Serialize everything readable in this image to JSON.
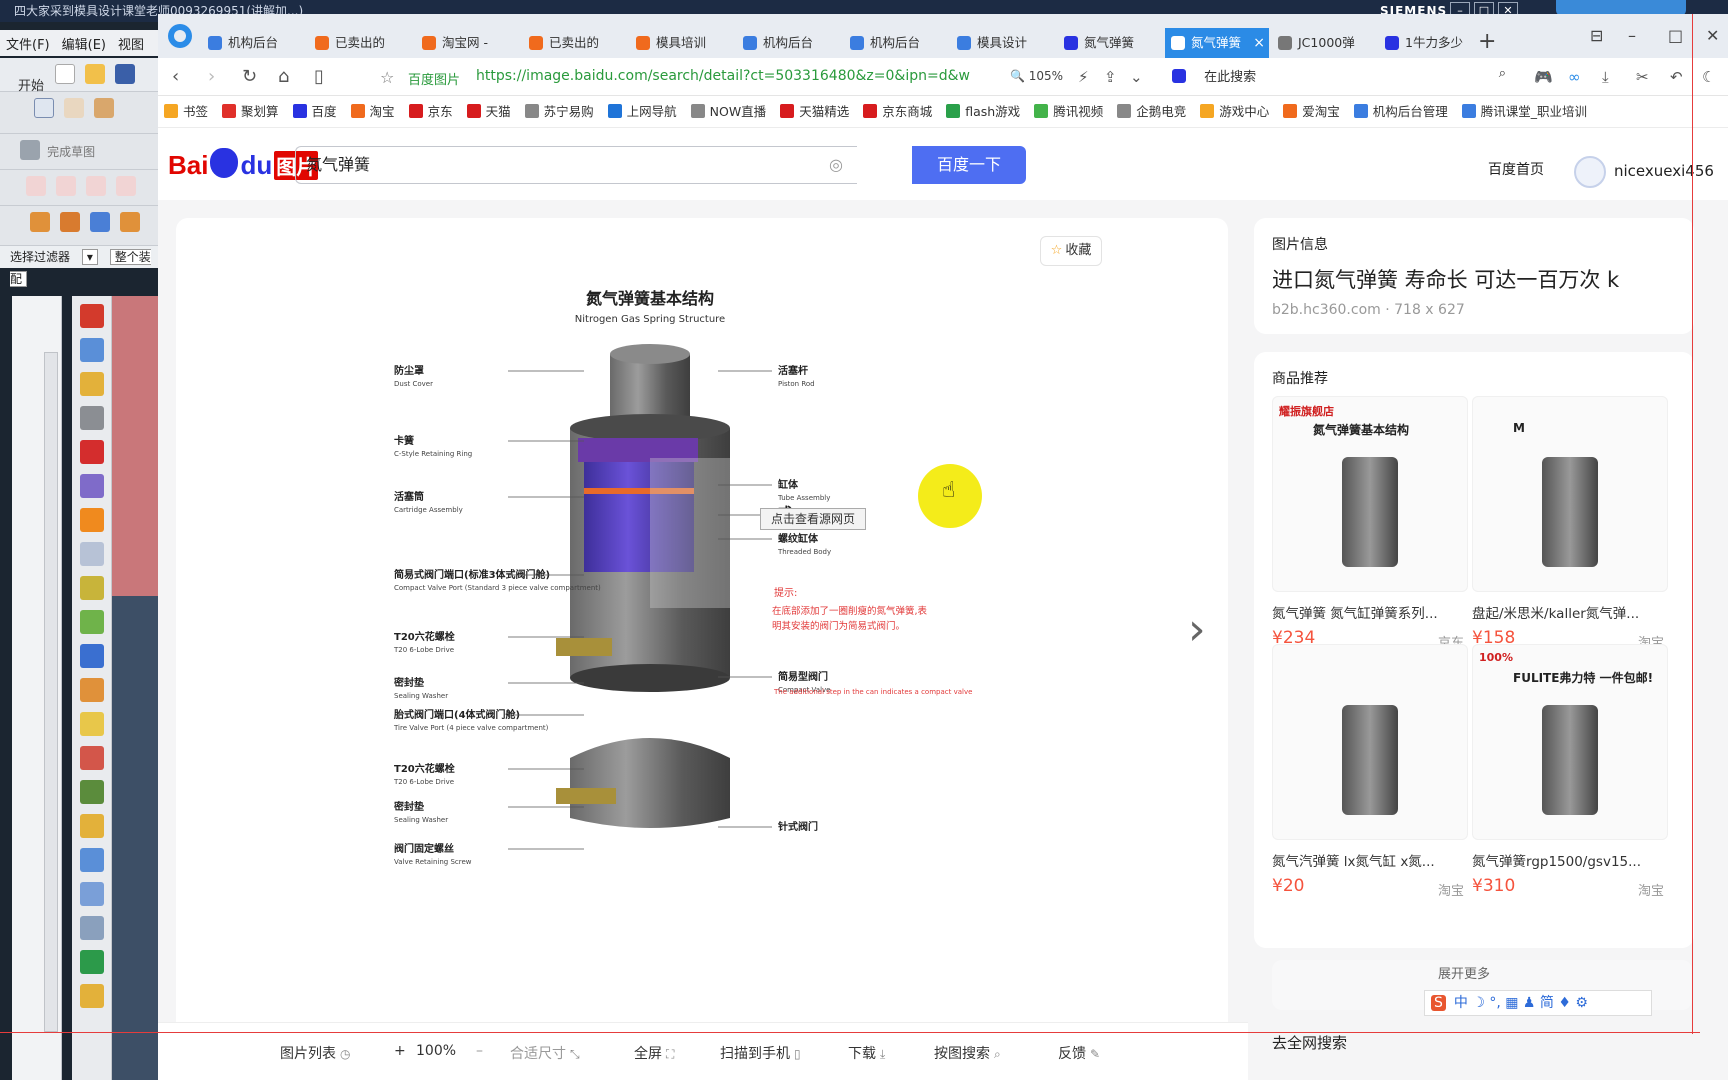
{
  "cad": {
    "title": "四大家采到模具设计课堂老师0093269951(讲解加...)",
    "brand": "SIEMENS",
    "menu": [
      "文件(F)",
      "编辑(E)",
      "视图"
    ],
    "start_label": "开始",
    "sketch_label": "完成草图",
    "filter_label": "选择过滤器",
    "assembly_label": "整个装配"
  },
  "browser": {
    "tabs": [
      {
        "label": "机构后台",
        "icon": "shield-icon",
        "color": "#3b7de0"
      },
      {
        "label": "已卖出的",
        "icon": "taobao-icon",
        "color": "#f06a1d"
      },
      {
        "label": "淘宝网 -",
        "icon": "taobao-icon",
        "color": "#f06a1d"
      },
      {
        "label": "已卖出的",
        "icon": "taobao-icon",
        "color": "#f06a1d"
      },
      {
        "label": "模具培训",
        "icon": "taobao-icon",
        "color": "#f06a1d"
      },
      {
        "label": "机构后台",
        "icon": "shield-icon",
        "color": "#3b7de0"
      },
      {
        "label": "机构后台",
        "icon": "shield-icon",
        "color": "#3b7de0"
      },
      {
        "label": "模具设计",
        "icon": "shield-icon",
        "color": "#3b7de0"
      },
      {
        "label": "氮气弹簧",
        "icon": "baidu-paw-icon",
        "color": "#2932e1"
      },
      {
        "label": "氮气弹簧",
        "icon": "baidu-paw-icon",
        "color": "#2932e1",
        "active": true
      },
      {
        "label": "JC1000弹",
        "icon": "globe-icon",
        "color": "#777777"
      },
      {
        "label": "1牛力多少",
        "icon": "baidu-paw-icon",
        "color": "#2932e1"
      }
    ],
    "address": {
      "site_label": "百度图片",
      "url": "https://image.baidu.com/search/detail?ct=503316480&z=0&ipn=d&w",
      "zoom": "105%",
      "search_placeholder": "在此搜索"
    },
    "bookmarks": [
      {
        "label": "书签",
        "icon": "star-icon",
        "color": "#f5a623"
      },
      {
        "label": "聚划算",
        "icon": "juhuasuan-icon",
        "color": "#e0302a"
      },
      {
        "label": "百度",
        "icon": "baidu-paw-icon",
        "color": "#2932e1"
      },
      {
        "label": "淘宝",
        "icon": "taobao-icon",
        "color": "#f06a1d"
      },
      {
        "label": "京东",
        "icon": "jd-icon",
        "color": "#d71c1e"
      },
      {
        "label": "天猫",
        "icon": "tmall-icon",
        "color": "#d71c1e"
      },
      {
        "label": "苏宁易购",
        "icon": "globe-icon",
        "color": "#888888"
      },
      {
        "label": "上网导航",
        "icon": "ie-icon",
        "color": "#1f74d8"
      },
      {
        "label": "NOW直播",
        "icon": "globe-icon",
        "color": "#888888"
      },
      {
        "label": "天猫精选",
        "icon": "tmall-icon",
        "color": "#d71c1e"
      },
      {
        "label": "京东商城",
        "icon": "jd-icon",
        "color": "#d71c1e"
      },
      {
        "label": "flash游戏",
        "icon": "game-icon",
        "color": "#2aa04a"
      },
      {
        "label": "腾讯视频",
        "icon": "video-icon",
        "color": "#43b34a"
      },
      {
        "label": "企鹅电竞",
        "icon": "globe-icon",
        "color": "#888888"
      },
      {
        "label": "游戏中心",
        "icon": "gamepad-icon",
        "color": "#f5a623"
      },
      {
        "label": "爱淘宝",
        "icon": "taobao-icon",
        "color": "#f06a1d"
      },
      {
        "label": "机构后台管理",
        "icon": "shield-icon",
        "color": "#3b7de0"
      },
      {
        "label": "腾讯课堂_职业培训",
        "icon": "shield-icon",
        "color": "#3b7de0"
      }
    ]
  },
  "baidu": {
    "logo_text": "Bai",
    "logo_du": "du",
    "logo_pic": "图片",
    "search_value": "氮气弹簧",
    "search_button": "百度一下",
    "home_link": "百度首页",
    "username": "nicexuexi456"
  },
  "viewer": {
    "collect_label": "收藏",
    "source_tip": "点击查看源网页",
    "diagram": {
      "title_cn": "氮气弹簧基本结构",
      "title_en": "Nitrogen Gas Spring Structure",
      "labels_left": [
        {
          "cn": "防尘罩",
          "en": "Dust Cover"
        },
        {
          "cn": "卡簧",
          "en": "C-Style Retaining Ring"
        },
        {
          "cn": "活塞筒",
          "en": "Cartridge Assembly"
        },
        {
          "cn": "简易式阀门端口(标准3体式阀门舱)",
          "en": "Compact Valve Port (Standard 3 piece valve compartment)"
        },
        {
          "cn": "T20六花螺栓",
          "en": "T20 6-Lobe Drive"
        },
        {
          "cn": "密封垫",
          "en": "Sealing Washer"
        },
        {
          "cn": "胎式阀门端口(4体式阀门舱)",
          "en": "Tire Valve Port (4 piece valve compartment)"
        },
        {
          "cn": "T20六花螺栓",
          "en": "T20 6-Lobe Drive"
        },
        {
          "cn": "密封垫",
          "en": "Sealing Washer"
        },
        {
          "cn": "阀门固定螺丝",
          "en": "Valve Retaining Screw"
        }
      ],
      "labels_right": [
        {
          "cn": "活塞杆",
          "en": "Piston Rod"
        },
        {
          "cn": "缸体",
          "en": "Tube Assembly"
        },
        {
          "cn": "或",
          "en": "or"
        },
        {
          "cn": "螺纹缸体",
          "en": "Threaded Body"
        },
        {
          "cn": "简易型阀门",
          "en": "Compact Valve"
        },
        {
          "cn": "针式阀门",
          "en": ""
        }
      ],
      "note_title": "提示:",
      "note_cn": "在底部添加了一圈削瘦的氮气弹簧,表明其安装的阀门为简易式阀门。",
      "note_en": "The additional step in the can indicates a compact valve"
    },
    "bottom": {
      "list": "图片列表",
      "zoom": "100%",
      "fit": "合适尺寸",
      "fullscreen": "全屏",
      "scan": "扫描到手机",
      "download": "下载",
      "search_by_image": "按图搜索",
      "feedback": "反馈"
    }
  },
  "sidebar": {
    "info_label": "图片信息",
    "title": "进口氮气弹簧 寿命长 可达一百万次 k",
    "meta": "b2b.hc360.com · 718 x 627",
    "products_label": "商品推荐",
    "products": [
      {
        "name": "氮气弹簧 氮气缸弹簧系列...",
        "price": "¥234",
        "store": "京东",
        "image_text": "氮气弹簧基本结构",
        "badge": "耀振旗舰店"
      },
      {
        "name": "盘起/米思米/kaller氮气弹...",
        "price": "¥158",
        "store": "淘宝",
        "image_text": "M",
        "badge": ""
      },
      {
        "name": "氮气汽弹簧 lx氮气缸 x氮...",
        "price": "¥20",
        "store": "淘宝",
        "image_text": "",
        "badge": ""
      },
      {
        "name": "氮气弹簧rgp1500/gsv15...",
        "price": "¥310",
        "store": "淘宝",
        "image_text": "FULITE弗力特 一件包邮!",
        "badge": "100%"
      }
    ],
    "more_label": "展开更多",
    "all_search": "去全网搜索",
    "ime": [
      "中",
      "简"
    ]
  }
}
